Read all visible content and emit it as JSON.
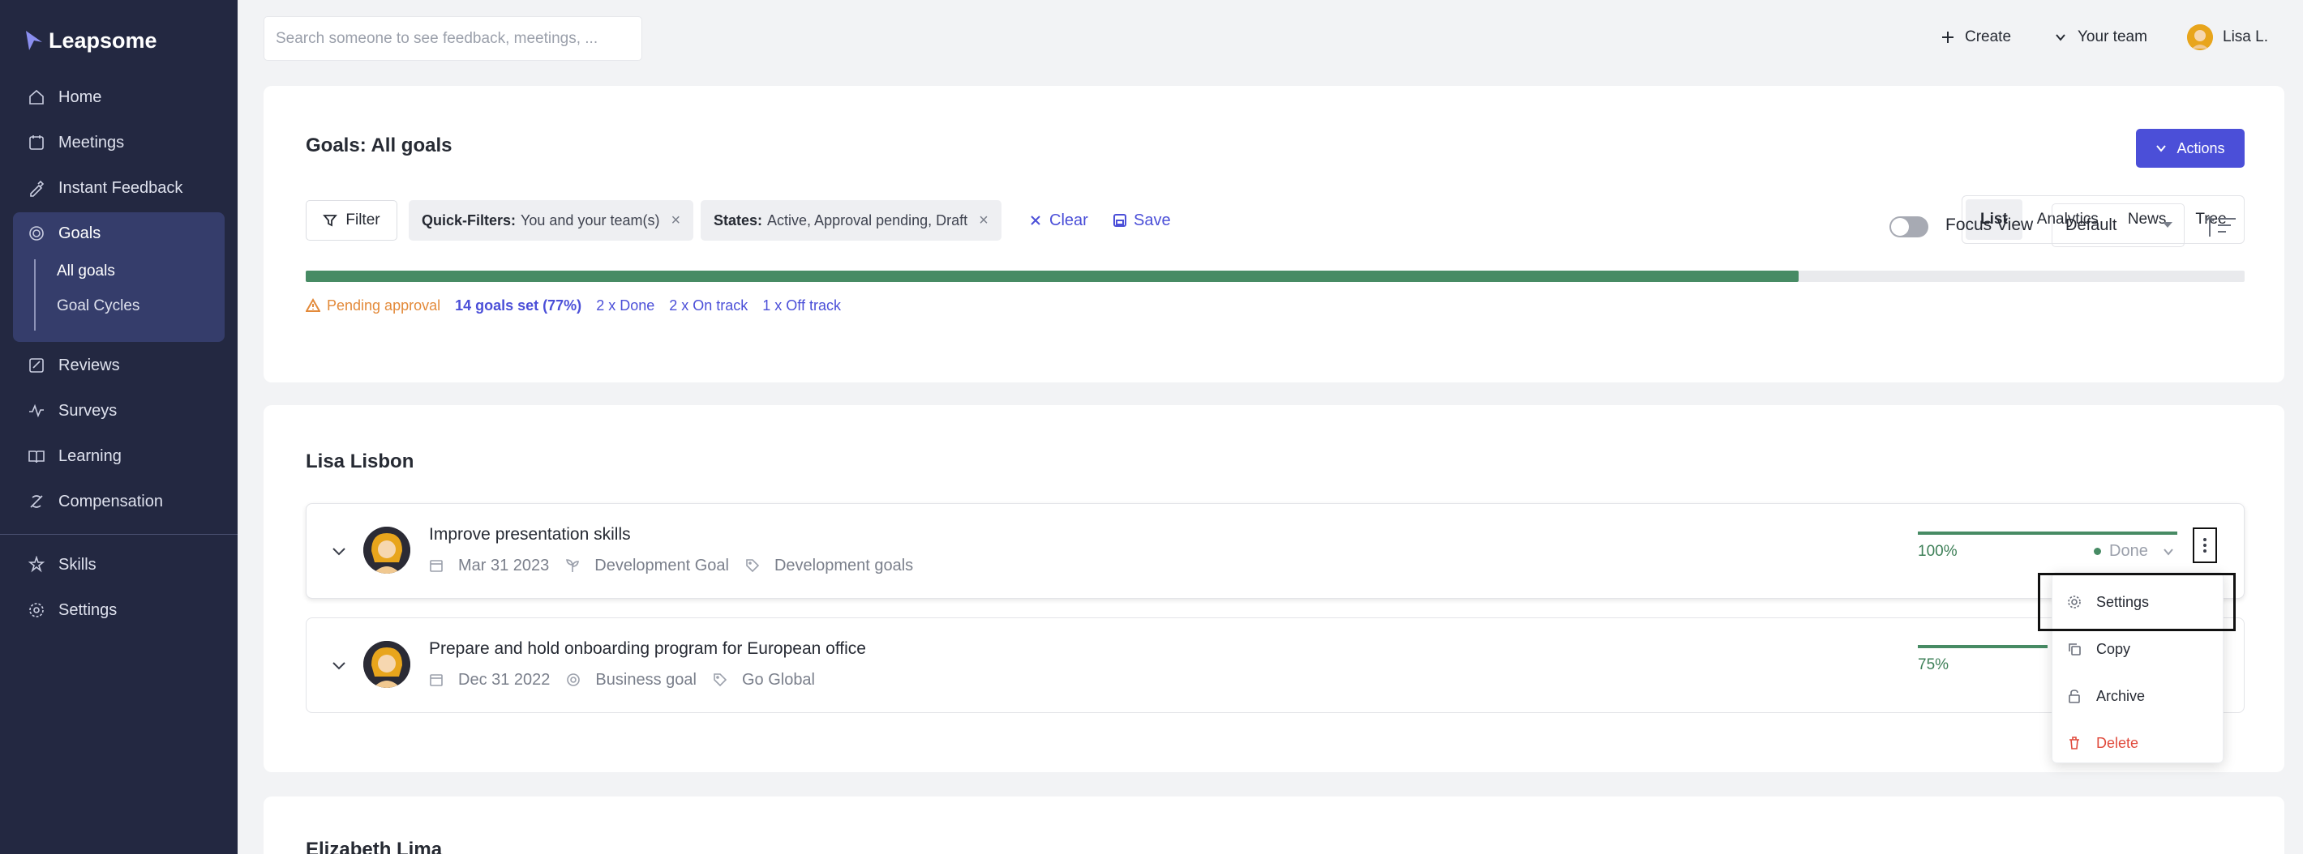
{
  "app": {
    "name": "Leapsome"
  },
  "sidebar": {
    "items": [
      {
        "label": "Home",
        "icon": "home-icon"
      },
      {
        "label": "Meetings",
        "icon": "meetings-icon"
      },
      {
        "label": "Instant Feedback",
        "icon": "feedback-icon"
      },
      {
        "label": "Goals",
        "icon": "goals-icon"
      },
      {
        "label": "Reviews",
        "icon": "reviews-icon"
      },
      {
        "label": "Surveys",
        "icon": "surveys-icon"
      },
      {
        "label": "Learning",
        "icon": "learning-icon"
      },
      {
        "label": "Compensation",
        "icon": "compensation-icon"
      },
      {
        "label": "Skills",
        "icon": "skills-icon"
      },
      {
        "label": "Settings",
        "icon": "settings-icon"
      }
    ],
    "goals_sub": [
      {
        "label": "All goals"
      },
      {
        "label": "Goal Cycles"
      }
    ]
  },
  "header": {
    "search_placeholder": "Search someone to see feedback, meetings, ...",
    "create_label": "Create",
    "team_label": "Your team",
    "user_label": "Lisa L."
  },
  "goals_page": {
    "title": "Goals: All goals",
    "actions_label": "Actions",
    "filter_label": "Filter",
    "chips": [
      {
        "key": "Quick-Filters:",
        "value": "You and your team(s)"
      },
      {
        "key": "States:",
        "value": "Active, Approval pending, Draft"
      }
    ],
    "clear_label": "Clear",
    "save_label": "Save",
    "views": [
      "List",
      "Analytics",
      "News",
      "Tree"
    ],
    "active_view": "List",
    "overall_progress": 0.77,
    "stats": {
      "pending": "Pending approval",
      "set": "14 goals set (77%)",
      "done": "2 x Done",
      "on_track": "2 x On track",
      "off_track": "1 x Off track"
    },
    "focus_view_label": "Focus View",
    "sort_select": "Default"
  },
  "sections": [
    {
      "name": "Lisa Lisbon",
      "goals": [
        {
          "title": "Improve presentation skills",
          "date": "Mar 31 2023",
          "type": "Development Goal",
          "tag": "Development goals",
          "progress": 1.0,
          "pct_label": "100%",
          "status": "Done"
        },
        {
          "title": "Prepare and hold onboarding program for European office",
          "date": "Dec 31 2022",
          "type": "Business goal",
          "tag": "Go Global",
          "progress": 0.75,
          "pct_label": "75%"
        }
      ]
    },
    {
      "name": "Elizabeth Lima"
    }
  ],
  "context_menu": {
    "items": [
      "Settings",
      "Copy",
      "Archive",
      "Delete"
    ]
  }
}
